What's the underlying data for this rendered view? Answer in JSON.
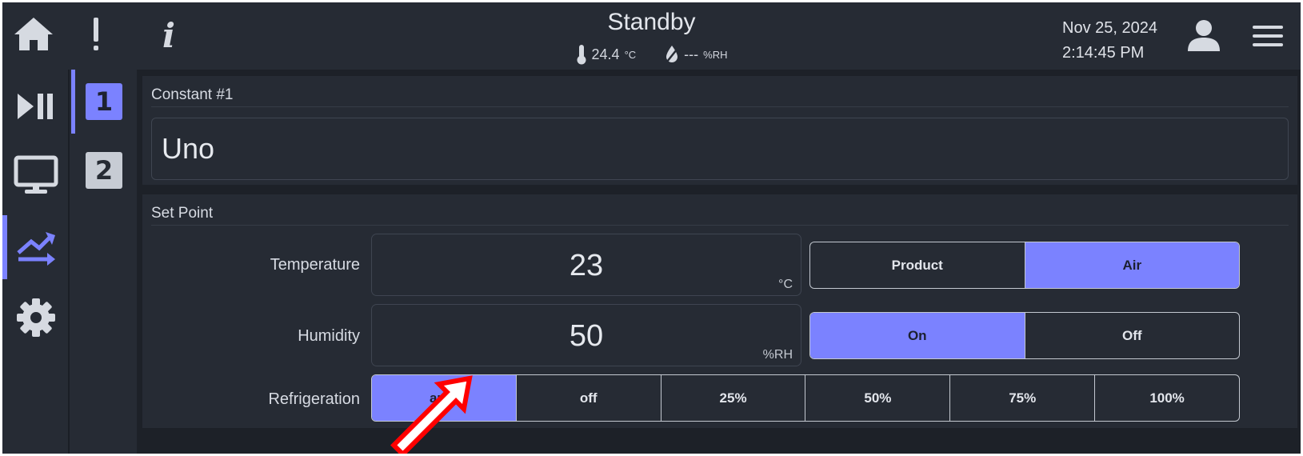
{
  "header": {
    "status": "Standby",
    "temperature_reading": "24.4",
    "temperature_unit": "°C",
    "humidity_reading": "---",
    "humidity_unit": "%RH",
    "date": "Nov 25, 2024",
    "time": "2:14:45 PM",
    "icons": [
      "home-icon",
      "alert-icon",
      "info-icon",
      "user-icon",
      "menu-icon"
    ]
  },
  "rail": {
    "items": [
      "run-pause-icon",
      "monitor-icon",
      "profiles-icon",
      "settings-icon"
    ],
    "active": "profiles-icon"
  },
  "subrail": {
    "items": [
      "1",
      "2"
    ],
    "active": "1"
  },
  "constant": {
    "title": "Constant #1",
    "name": "Uno"
  },
  "setpoint": {
    "title": "Set Point",
    "temperature": {
      "label": "Temperature",
      "value": "23",
      "unit": "°C",
      "options": [
        "Product",
        "Air"
      ],
      "selected": "Air"
    },
    "humidity": {
      "label": "Humidity",
      "value": "50",
      "unit": "%RH",
      "options": [
        "On",
        "Off"
      ],
      "selected": "On"
    },
    "refrigeration": {
      "label": "Refrigeration",
      "options": [
        "auto",
        "off",
        "25%",
        "50%",
        "75%",
        "100%"
      ],
      "selected": "auto"
    }
  },
  "colors": {
    "accent": "#7b82ff",
    "background": "#262b34",
    "annotation_arrow": "#ff0000"
  }
}
